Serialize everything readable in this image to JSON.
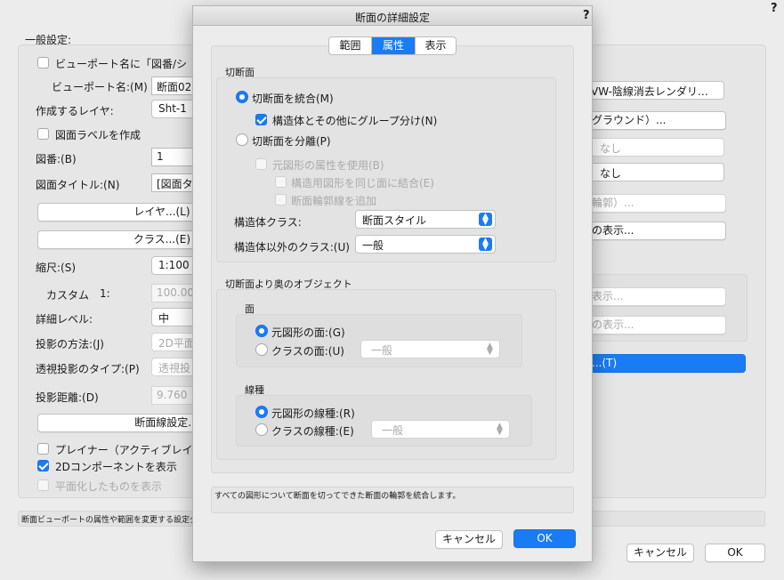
{
  "bg": {
    "help": "?",
    "general_label": "一般設定:",
    "viewport_name_check": "ビューポート名に「図番/シ",
    "viewport_name_label": "ビューポート名:(M)",
    "viewport_name_value": "断面02",
    "layer_label": "作成するレイヤ:",
    "layer_value": "Sht-1",
    "drawing_label_check": "図面ラベルを作成",
    "drawing_no_label": "図番:(B)",
    "drawing_no_value": "1",
    "drawing_title_label": "図面タイトル:(N)",
    "drawing_title_value": "[図面タイ",
    "layer_btn": "レイヤ...(L)",
    "class_btn": "クラス...(E)",
    "scale_label": "縮尺:(S)",
    "scale_value": "1:100",
    "custom_label": "カスタム",
    "custom_one": "1:",
    "custom_value": "100.000",
    "detail_label": "詳細レベル:",
    "detail_value": "中",
    "projection_label": "投影の方法:(J)",
    "projection_value": "2D平面",
    "persp_label": "透視投影のタイプ:(P)",
    "persp_value": "透視投",
    "distance_label": "投影距離:(D)",
    "distance_value": "9.760",
    "section_line_btn": "断面線設定...",
    "planar_check": "プレイナー（アクティブレイ",
    "twod_check": "2Dコンポーネントを表示",
    "flatten_check": "平面化したものを表示",
    "render_value": "VW-陰線消去レンダリ…",
    "background_btn": "グラウンド）...",
    "none1": "なし",
    "none2": "なし",
    "contour_btn": "輪郭）...",
    "show_btn1": "の表示...",
    "show_btn2": "表示...",
    "show_btn3": "の表示...",
    "t_btn": "...(T)",
    "status": "断面ビューポートの属性や範囲を変更する設定ダイ",
    "cancel": "キャンセル",
    "ok": "OK"
  },
  "dialog": {
    "title": "断面の詳細設定",
    "help": "?",
    "tabs": [
      "範囲",
      "属性",
      "表示"
    ],
    "active_tab": "属性",
    "cut_section": {
      "heading": "切断面",
      "merge_radio": "切断面を統合(M)",
      "group_check": "構造体とその他にグループ分け(N)",
      "separate_radio": "切断面を分離(P)",
      "use_attr_check": "元図形の属性を使用(B)",
      "merge_same_check": "構造用図形を同じ面に結合(E)",
      "add_outline_check": "断面輪郭線を追加",
      "struct_class_label": "構造体クラス:",
      "struct_class_value": "断面スタイル",
      "nonstruct_class_label": "構造体以外のクラス:(U)",
      "nonstruct_class_value": "一般"
    },
    "beyond": {
      "heading": "切断面より奥のオブジェクト",
      "face_heading": "面",
      "face_orig_radio": "元図形の面:(G)",
      "face_class_radio": "クラスの面:(U)",
      "face_class_value": "一般",
      "line_heading": "線種",
      "line_orig_radio": "元図形の線種:(R)",
      "line_class_radio": "クラスの線種:(E)",
      "line_class_value": "一般"
    },
    "help_text": "すべての図形について断面を切ってできた断面の輪郭を統合します。",
    "cancel": "キャンセル",
    "ok": "OK"
  }
}
